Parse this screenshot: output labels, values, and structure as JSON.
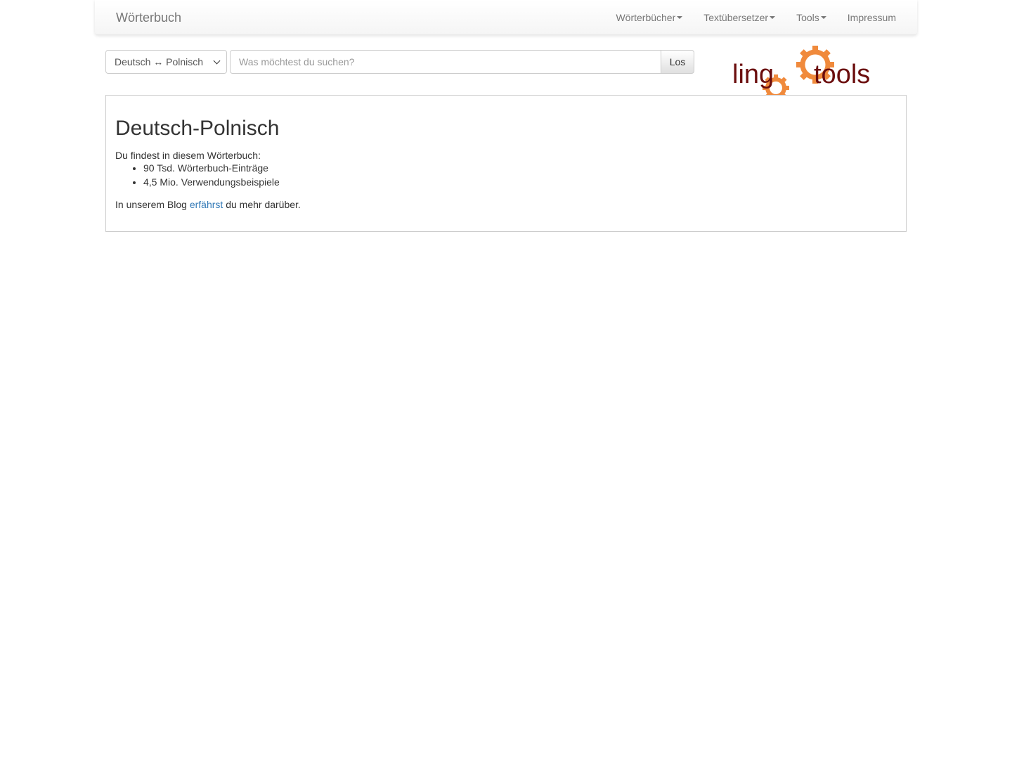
{
  "navbar": {
    "brand": "Wörterbuch",
    "items": [
      {
        "label": "Wörterbücher"
      },
      {
        "label": "Textübersetzer"
      },
      {
        "label": "Tools"
      },
      {
        "label": "Impressum"
      }
    ]
  },
  "search": {
    "language_selected": "Deutsch ↔ Polnisch",
    "placeholder": "Was möchtest du suchen?",
    "value": "",
    "button_label": "Los"
  },
  "logo": {
    "text_left": "ling",
    "text_right": "tools",
    "text_color": "#6b0d0d",
    "gear_color": "#f08a3c"
  },
  "content": {
    "title": "Deutsch-Polnisch",
    "intro": "Du findest in diesem Wörterbuch:",
    "stats": [
      "90 Tsd. Wörterbuch-Einträge",
      "4,5 Mio. Verwendungsbeispiele"
    ],
    "blog_prefix": "In unserem Blog ",
    "blog_link": "erfährst",
    "blog_suffix": " du mehr darüber."
  }
}
